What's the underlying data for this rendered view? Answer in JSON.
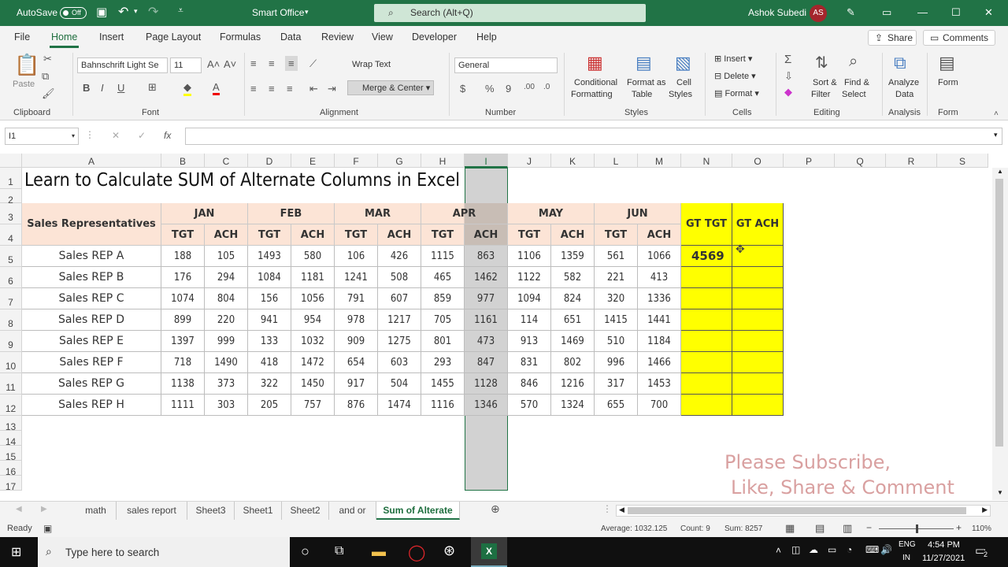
{
  "titlebar": {
    "autosave": "AutoSave",
    "toggle": "Off",
    "app_title": "Smart Office",
    "search_placeholder": "Search (Alt+Q)",
    "user": "Ashok Subedi",
    "initials": "AS"
  },
  "menu": {
    "items": [
      "File",
      "Home",
      "Insert",
      "Page Layout",
      "Formulas",
      "Data",
      "Review",
      "View",
      "Developer",
      "Help"
    ],
    "share": "Share",
    "comments": "Comments"
  },
  "ribbon": {
    "clipboard": {
      "paste": "Paste",
      "group": "Clipboard"
    },
    "font": {
      "name": "Bahnschrift Light Se",
      "size": "11",
      "group": "Font"
    },
    "alignment": {
      "wrap": "Wrap Text",
      "merge": "Merge & Center",
      "group": "Alignment"
    },
    "number": {
      "format": "General",
      "group": "Number"
    },
    "styles": {
      "cond1": "Conditional",
      "cond2": "Formatting",
      "fmt1": "Format as",
      "fmt2": "Table",
      "cell1": "Cell",
      "cell2": "Styles",
      "group": "Styles"
    },
    "cells": {
      "insert": "Insert",
      "delete": "Delete",
      "format": "Format",
      "group": "Cells"
    },
    "editing": {
      "sort1": "Sort &",
      "sort2": "Filter",
      "find1": "Find &",
      "find2": "Select",
      "group": "Editing"
    },
    "analysis": {
      "a1": "Analyze",
      "a2": "Data",
      "group": "Analysis"
    },
    "form": {
      "label": "Form",
      "group": "Form"
    }
  },
  "formula_bar": {
    "name_box": "I1",
    "fx": "fx",
    "value": ""
  },
  "sheet": {
    "columns": [
      "A",
      "B",
      "C",
      "D",
      "E",
      "F",
      "G",
      "H",
      "I",
      "J",
      "K",
      "L",
      "M",
      "N",
      "O",
      "P",
      "Q",
      "R",
      "S"
    ],
    "rows": [
      "1",
      "2",
      "3",
      "4",
      "5",
      "6",
      "7",
      "8",
      "9",
      "10",
      "11",
      "12",
      "13",
      "14",
      "15",
      "16",
      "17"
    ],
    "title": "Learn to Calculate SUM of Alternate Columns  in Excel",
    "rep_header": "Sales Representatives",
    "months": [
      "JAN",
      "FEB",
      "MAR",
      "APR",
      "MAY",
      "JUN"
    ],
    "sub": [
      "TGT",
      "ACH"
    ],
    "gt_tgt": "GT TGT",
    "gt_ach": "GT ACH",
    "result": "4569",
    "reps": [
      "Sales REP A",
      "Sales REP B",
      "Sales REP C",
      "Sales REP D",
      "Sales REP E",
      "Sales REP F",
      "Sales REP G",
      "Sales REP H"
    ],
    "values": [
      [
        "188",
        "105",
        "1493",
        "580",
        "106",
        "426",
        "1115",
        "863",
        "1106",
        "1359",
        "561",
        "1066"
      ],
      [
        "176",
        "294",
        "1084",
        "1181",
        "1241",
        "508",
        "465",
        "1462",
        "1122",
        "582",
        "221",
        "413"
      ],
      [
        "1074",
        "804",
        "156",
        "1056",
        "791",
        "607",
        "859",
        "977",
        "1094",
        "824",
        "320",
        "1336"
      ],
      [
        "899",
        "220",
        "941",
        "954",
        "978",
        "1217",
        "705",
        "1161",
        "114",
        "651",
        "1415",
        "1441"
      ],
      [
        "1397",
        "999",
        "133",
        "1032",
        "909",
        "1275",
        "801",
        "473",
        "913",
        "1469",
        "510",
        "1184"
      ],
      [
        "718",
        "1490",
        "418",
        "1472",
        "654",
        "603",
        "293",
        "847",
        "831",
        "802",
        "996",
        "1466"
      ],
      [
        "1138",
        "373",
        "322",
        "1450",
        "917",
        "504",
        "1455",
        "1128",
        "846",
        "1216",
        "317",
        "1453"
      ],
      [
        "1111",
        "303",
        "205",
        "757",
        "876",
        "1474",
        "1116",
        "1346",
        "570",
        "1324",
        "655",
        "700"
      ]
    ],
    "watermark1": "Please Subscribe,",
    "watermark2": "Like, Share & Comment"
  },
  "tabs": [
    "math",
    "sales report",
    "Sheet3",
    "Sheet1",
    "Sheet2",
    "and or",
    "Sum of Alterate"
  ],
  "status": {
    "ready": "Ready",
    "average": "Average: 1032.125",
    "count": "Count: 9",
    "sum": "Sum: 8257",
    "zoom": "110%"
  },
  "taskbar": {
    "search": "Type here to search",
    "lang1": "ENG",
    "lang2": "IN",
    "time": "4:54 PM",
    "date": "11/27/2021",
    "notif": "2"
  },
  "colors": {
    "excel_green": "#217346",
    "peach": "#fce4d6",
    "yellow": "#ffff00",
    "selected_col": "#d2d2d2",
    "watermark": "#d9a0a0"
  }
}
